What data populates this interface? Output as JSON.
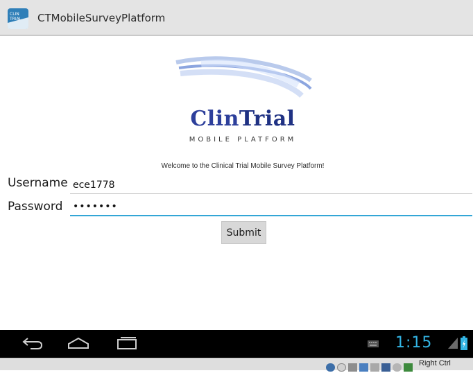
{
  "actionbar": {
    "app_title": "CTMobileSurveyPlatform",
    "app_icon_text": "CLIN TRIAL"
  },
  "logo": {
    "brand_part1": "Clin",
    "brand_part2": "Trial",
    "tagline": "MOBILE PLATFORM"
  },
  "form": {
    "welcome": "Welcome to the Clinical Trial Mobile Survey Platform!",
    "username_label": "Username",
    "username_value": "ece1778",
    "password_label": "Password",
    "password_value": "•••••••",
    "submit_label": "Submit"
  },
  "navbar": {
    "icons": [
      "back-icon",
      "home-icon",
      "recent-apps-icon",
      "keyboard-icon",
      "signal-icon",
      "battery-icon"
    ],
    "clock": "1:15",
    "accent": "#33b5e5"
  },
  "host": {
    "key_label": "Right Ctrl"
  }
}
